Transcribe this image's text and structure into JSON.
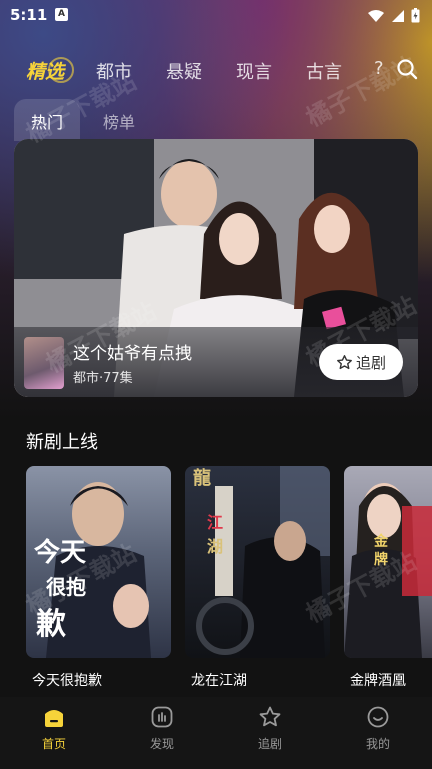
{
  "status_bar": {
    "time": "5:11",
    "app_badge": "A"
  },
  "top_nav": {
    "items": [
      "精选",
      "都市",
      "悬疑",
      "现言",
      "古言",
      "?"
    ],
    "active_index": 0
  },
  "sub_tabs": {
    "items": [
      "热门",
      "榜单"
    ],
    "active_index": 0
  },
  "hero": {
    "title": "这个姑爷有点拽",
    "meta": "都市·77集",
    "follow_label": "追剧"
  },
  "new_section": {
    "title": "新剧上线",
    "cards": [
      {
        "title": "今天很抱歉",
        "poster_text": "今天很抱歉"
      },
      {
        "title": "龙在江湖",
        "poster_text": "龍在江湖"
      },
      {
        "title": "金牌酒凰",
        "poster_text": "金牌"
      }
    ]
  },
  "watermark": "橘子下载站",
  "bottom_nav": {
    "items": [
      {
        "label": "首页",
        "icon": "home-icon",
        "active": true
      },
      {
        "label": "发现",
        "icon": "discover-icon",
        "active": false
      },
      {
        "label": "追剧",
        "icon": "star-icon",
        "active": false
      },
      {
        "label": "我的",
        "icon": "profile-icon",
        "active": false
      }
    ]
  },
  "colors": {
    "accent": "#f6d33a",
    "bg": "#121212"
  }
}
